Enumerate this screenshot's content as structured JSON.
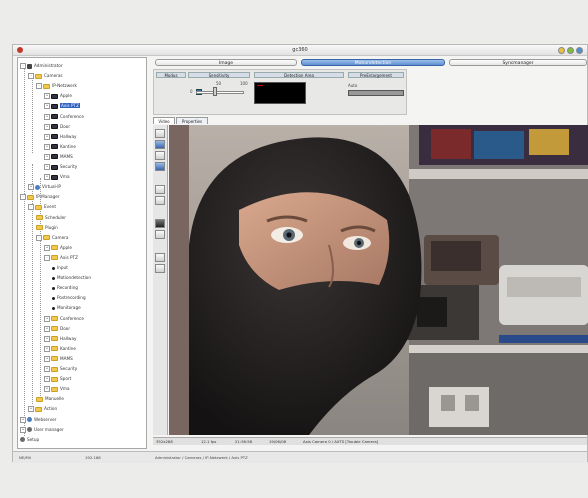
{
  "window": {
    "title": "gc360"
  },
  "tree": [
    {
      "label": "Administrator",
      "icon": "user",
      "indent": 0,
      "expander": "-"
    },
    {
      "label": "Cameras",
      "icon": "folder",
      "indent": 1,
      "expander": "-"
    },
    {
      "label": "IP-Netzwerk",
      "icon": "folder",
      "indent": 2,
      "expander": "-"
    },
    {
      "label": "Apple",
      "icon": "cam",
      "indent": 3,
      "expander": "+"
    },
    {
      "label": "Axis PTZ",
      "icon": "cam",
      "indent": 3,
      "expander": "+",
      "selected": true
    },
    {
      "label": "Conference",
      "icon": "cam",
      "indent": 3,
      "expander": "+"
    },
    {
      "label": "Door",
      "icon": "cam",
      "indent": 3,
      "expander": "+"
    },
    {
      "label": "Hallway",
      "icon": "cam",
      "indent": 3,
      "expander": "+"
    },
    {
      "label": "Kantine",
      "icon": "cam",
      "indent": 3,
      "expander": "+"
    },
    {
      "label": "MAMS",
      "icon": "cam",
      "indent": 3,
      "expander": "+"
    },
    {
      "label": "Security",
      "icon": "cam",
      "indent": 3,
      "expander": "+"
    },
    {
      "label": "Vma",
      "icon": "cam",
      "indent": 3,
      "expander": "+"
    },
    {
      "label": "Virtual-IP",
      "icon": "globe",
      "indent": 1,
      "expander": "+"
    },
    {
      "label": "IP-Manager",
      "icon": "folder",
      "indent": 0,
      "expander": "-"
    },
    {
      "label": "Event",
      "icon": "folder",
      "indent": 1,
      "expander": "-"
    },
    {
      "label": "Scheduler",
      "icon": "folder",
      "indent": 2,
      "expander": ""
    },
    {
      "label": "Plugin",
      "icon": "folder",
      "indent": 2,
      "expander": ""
    },
    {
      "label": "Camera",
      "icon": "folder",
      "indent": 2,
      "expander": "-"
    },
    {
      "label": "Apple",
      "icon": "folder",
      "indent": 3,
      "expander": "+"
    },
    {
      "label": "Axis PTZ",
      "icon": "folder",
      "indent": 3,
      "expander": "-"
    },
    {
      "label": "Input",
      "icon": "dot",
      "indent": 4,
      "expander": ""
    },
    {
      "label": "Motiondetection",
      "icon": "dot",
      "indent": 4,
      "expander": ""
    },
    {
      "label": "Recording",
      "icon": "dot",
      "indent": 4,
      "expander": ""
    },
    {
      "label": "Postrecording",
      "icon": "dot",
      "indent": 4,
      "expander": ""
    },
    {
      "label": "Monitorage",
      "icon": "dot",
      "indent": 4,
      "expander": ""
    },
    {
      "label": "Conference",
      "icon": "folder",
      "indent": 3,
      "expander": "+"
    },
    {
      "label": "Door",
      "icon": "folder",
      "indent": 3,
      "expander": "+"
    },
    {
      "label": "Hallway",
      "icon": "folder",
      "indent": 3,
      "expander": "+"
    },
    {
      "label": "Kantine",
      "icon": "folder",
      "indent": 3,
      "expander": "+"
    },
    {
      "label": "MAMS",
      "icon": "folder",
      "indent": 3,
      "expander": "+"
    },
    {
      "label": "Security",
      "icon": "folder",
      "indent": 3,
      "expander": "+"
    },
    {
      "label": "Sport",
      "icon": "folder",
      "indent": 3,
      "expander": "+"
    },
    {
      "label": "Vma",
      "icon": "folder",
      "indent": 3,
      "expander": "+"
    },
    {
      "label": "Manuelle",
      "icon": "folder",
      "indent": 2,
      "expander": ""
    },
    {
      "label": "Action",
      "icon": "folder",
      "indent": 1,
      "expander": "+"
    },
    {
      "label": "Webserver",
      "icon": "globe",
      "indent": 0,
      "expander": "+"
    },
    {
      "label": "User manager",
      "icon": "gear",
      "indent": 0,
      "expander": "+"
    },
    {
      "label": "Setup",
      "icon": "gear",
      "indent": 0,
      "expander": ""
    }
  ],
  "tabs": {
    "image": "Image",
    "motion": "Motiondetection",
    "sync": "Syncmanager"
  },
  "panel": {
    "head1": "Modus",
    "head2": "Sensitivity",
    "head3": "Detection Area",
    "head4": "PreEnlargement",
    "slider_value": "50",
    "slider_min": "0",
    "slider_max": "100",
    "combo_label": "Auto",
    "slider_fraction": 0.4
  },
  "subtabs": {
    "video": "Video",
    "properties": "Properties"
  },
  "status": {
    "resolution": "352x288",
    "fps": "12.1 fps",
    "time": "21:36:58",
    "date": "19/06/08",
    "source": "Axis Camera 0 / AXTS [Trouble Camera]"
  },
  "bottom": {
    "left1": "NE/Mil",
    "left2": "192.168",
    "path": "Administrator / Cameras / IP-Netzwerk / Axis PTZ"
  }
}
